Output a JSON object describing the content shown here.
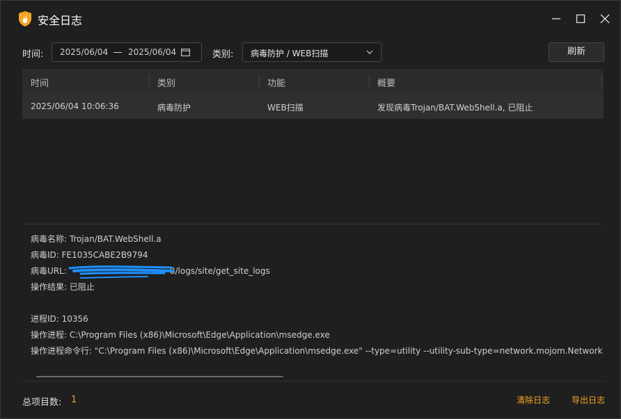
{
  "window": {
    "title": "安全日志"
  },
  "filters": {
    "time_label": "时间:",
    "date_start": "2025/06/04",
    "date_end": "2025/06/04",
    "category_label": "类别:",
    "category_value": "病毒防护 / WEB扫描",
    "refresh_label": "刷新"
  },
  "table": {
    "columns": [
      "时间",
      "类别",
      "功能",
      "概要"
    ],
    "rows": [
      {
        "time": "2025/06/04 10:06:36",
        "category": "病毒防护",
        "function": "WEB扫描",
        "summary": "发现病毒Trojan/BAT.WebShell.a, 已阻止"
      }
    ]
  },
  "details": {
    "virus_name": "病毒名称:  Trojan/BAT.WebShell.a",
    "virus_id": "病毒ID:  FE1035CABE2B9794",
    "virus_url_label": "病毒URL:",
    "virus_url_tail": "8/logs/site/get_site_logs",
    "result": "操作结果:  已阻止",
    "pid": "进程ID:  10356",
    "process": "操作进程:  C:\\Program Files (x86)\\Microsoft\\Edge\\Application\\msedge.exe",
    "cmdline": "操作进程命令行:  \"C:\\Program Files (x86)\\Microsoft\\Edge\\Application\\msedge.exe\" --type=utility --utility-sub-type=network.mojom.NetworkSer"
  },
  "footer": {
    "total_label": "总项目数:",
    "total_count": "1",
    "clear_label": "清除日志",
    "export_label": "导出日志"
  },
  "colors": {
    "accent": "#f5a623",
    "background": "#1f1f1f",
    "redaction": "#1e90ff"
  },
  "icons": {
    "logo": "shield-flame-icon",
    "minimize": "minimize-icon",
    "maximize": "maximize-icon",
    "close": "close-icon",
    "calendar": "calendar-icon",
    "dropdown": "chevron-down-icon"
  }
}
